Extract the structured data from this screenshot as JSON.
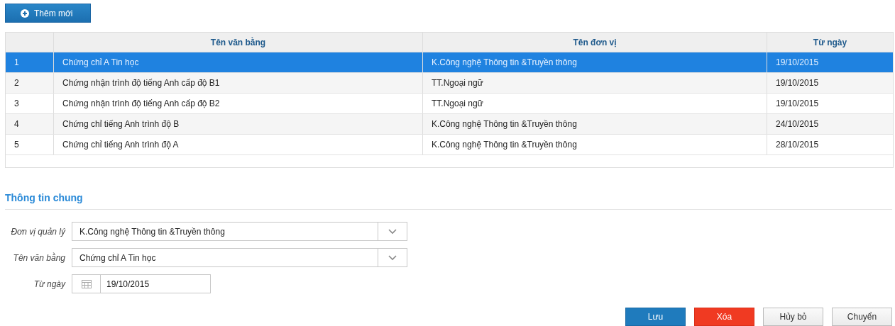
{
  "add_button": {
    "label": "Thêm mới"
  },
  "table": {
    "columns": [
      "",
      "Tên văn bằng",
      "Tên đơn vị",
      "Từ ngày"
    ],
    "rows": [
      {
        "cells": [
          "1",
          "Chứng chỉ A Tin học",
          "K.Công nghệ Thông tin &Truyền thông",
          "19/10/2015"
        ],
        "selected": true
      },
      {
        "cells": [
          "2",
          "Chứng nhận trình độ tiếng Anh cấp độ B1",
          "TT.Ngoại ngữ",
          "19/10/2015"
        ],
        "selected": false
      },
      {
        "cells": [
          "3",
          "Chứng nhận trình độ tiếng Anh cấp độ B2",
          "TT.Ngoại ngữ",
          "19/10/2015"
        ],
        "selected": false
      },
      {
        "cells": [
          "4",
          "Chứng chỉ tiếng Anh trình độ B",
          "K.Công nghệ Thông tin &Truyền thông",
          "24/10/2015"
        ],
        "selected": false
      },
      {
        "cells": [
          "5",
          "Chứng chỉ tiếng Anh trình độ A",
          "K.Công nghệ Thông tin &Truyền thông",
          "28/10/2015"
        ],
        "selected": false
      }
    ]
  },
  "section_title": "Thông tin chung",
  "form": [
    {
      "kind": "select",
      "label": "Đơn vị quản lý",
      "value": "K.Công nghệ Thông tin &Truyền thông"
    },
    {
      "kind": "select",
      "label": "Tên văn bằng",
      "value": "Chứng chỉ A Tin học"
    },
    {
      "kind": "date",
      "label": "Từ ngày",
      "value": "19/10/2015"
    }
  ],
  "buttons": [
    {
      "kind": "primary",
      "label": "Lưu"
    },
    {
      "kind": "danger",
      "label": "Xóa"
    },
    {
      "kind": "default",
      "label": "Hủy bỏ"
    },
    {
      "kind": "default",
      "label": "Chuyển"
    }
  ]
}
